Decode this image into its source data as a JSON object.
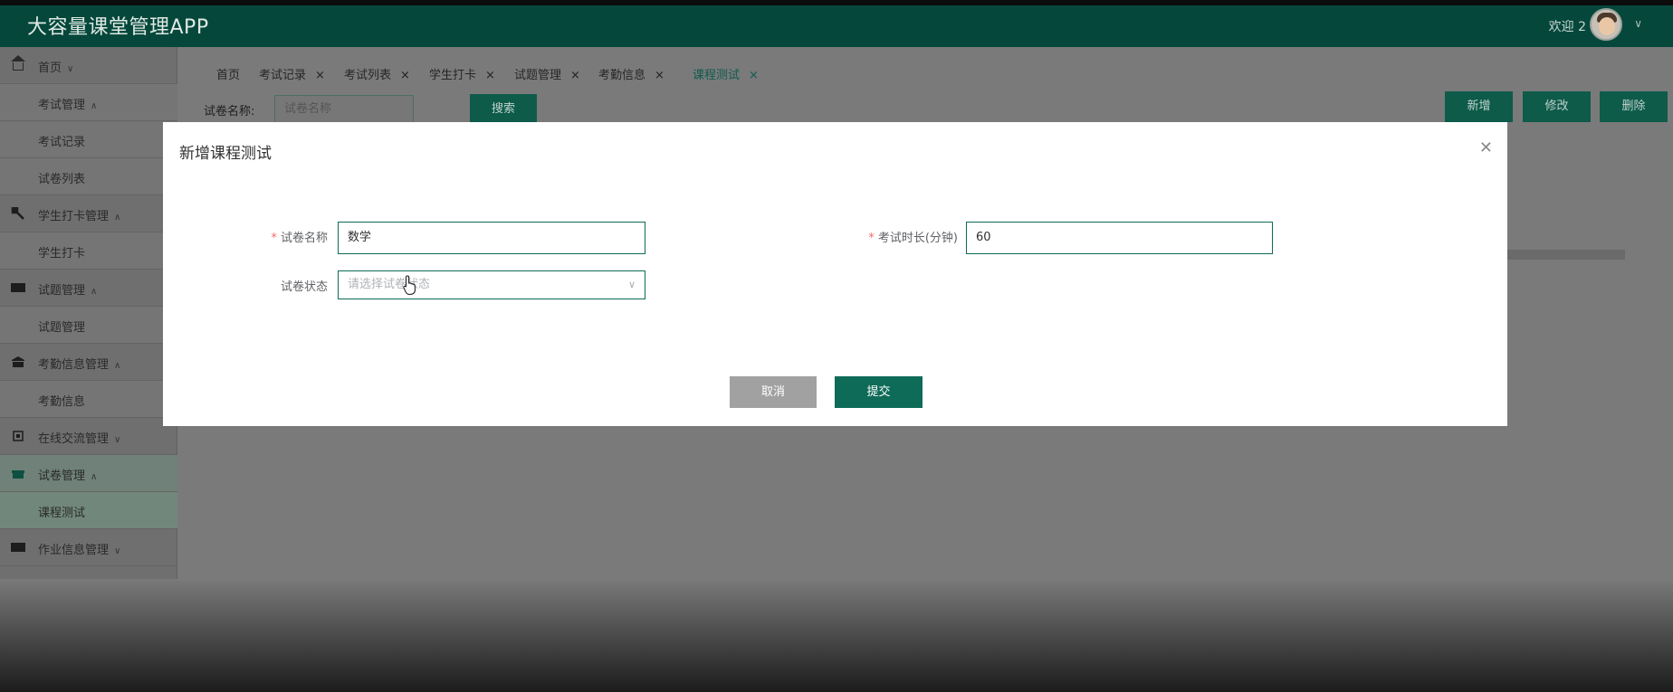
{
  "header": {
    "app_title": "大容量课堂管理APP",
    "welcome": "欢迎 2",
    "avatar_icon": "user-avatar-icon",
    "chevron_icon": "chevron-down-icon"
  },
  "sidebar": {
    "items": [
      {
        "label": "首页",
        "icon": "home-icon",
        "level": "top"
      },
      {
        "label": "考试管理",
        "icon": "",
        "level": "sub"
      },
      {
        "label": "考试记录",
        "icon": "",
        "level": "sub"
      },
      {
        "label": "试卷列表",
        "icon": "",
        "level": "sub"
      },
      {
        "label": "学生打卡管理",
        "icon": "pin-icon",
        "level": "top"
      },
      {
        "label": "学生打卡",
        "icon": "",
        "level": "sub"
      },
      {
        "label": "试题管理",
        "icon": "list-icon",
        "level": "top"
      },
      {
        "label": "试题管理",
        "icon": "",
        "level": "sub"
      },
      {
        "label": "考勤信息管理",
        "icon": "building-icon",
        "level": "top"
      },
      {
        "label": "考勤信息",
        "icon": "",
        "level": "sub"
      },
      {
        "label": "在线交流管理",
        "icon": "chip-icon",
        "level": "top"
      },
      {
        "label": "试卷管理",
        "icon": "gift-icon",
        "level": "top"
      },
      {
        "label": "课程测试",
        "icon": "",
        "level": "sub-active"
      },
      {
        "label": "作业信息管理",
        "icon": "monitor-icon",
        "level": "top"
      }
    ]
  },
  "tabs": [
    {
      "label": "首页",
      "closable": false
    },
    {
      "label": "考试记录",
      "closable": true
    },
    {
      "label": "考试列表",
      "closable": true
    },
    {
      "label": "学生打卡",
      "closable": true
    },
    {
      "label": "试题管理",
      "closable": true
    },
    {
      "label": "考勤信息",
      "closable": true
    },
    {
      "label": "课程测试",
      "closable": true,
      "active": true
    }
  ],
  "tab_close_glyph": "×",
  "search": {
    "label": "试卷名称:",
    "placeholder": "试卷名称",
    "button": "搜索"
  },
  "actions": {
    "add": "新增",
    "edit": "修改",
    "delete": "删除"
  },
  "modal": {
    "title": "新增课程测试",
    "close_icon": "close-icon",
    "fields": {
      "paper_name_label": "试卷名称",
      "paper_name_value": "数学",
      "duration_label": "考试时长(分钟)",
      "duration_value": "60",
      "status_label": "试卷状态",
      "status_placeholder": "请选择试卷状态"
    },
    "required_mark": "*",
    "cancel": "取消",
    "submit": "提交"
  },
  "colors": {
    "primary": "#0e6b57",
    "header": "#05483b",
    "required": "#f56c6c"
  }
}
